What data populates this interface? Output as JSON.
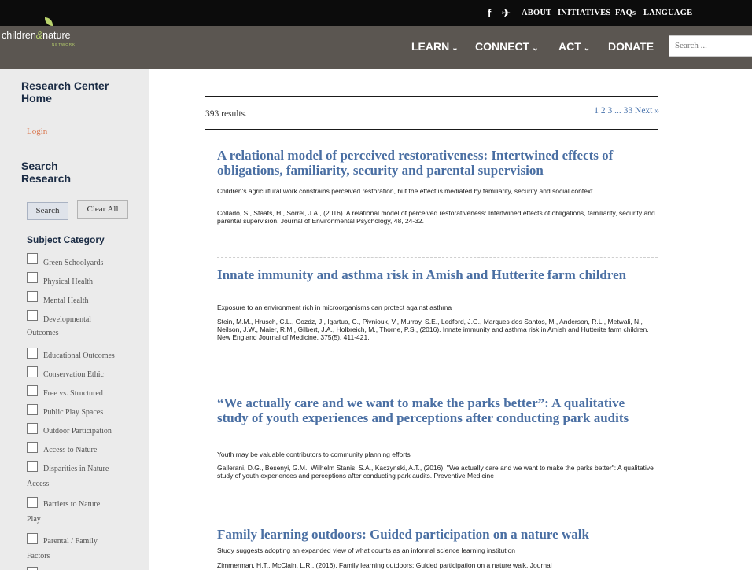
{
  "topbar": {
    "facebook_icon": "f",
    "twitter_icon": "✈",
    "links": [
      "ABOUT",
      "INITIATIVES",
      "FAQs",
      "LANGUAGE"
    ]
  },
  "logo": {
    "text_left": "children",
    "text_and": "&",
    "text_right": "nature",
    "sub": "NETWORK"
  },
  "nav": {
    "items": [
      "LEARN",
      "CONNECT",
      "ACT",
      "DONATE"
    ],
    "chevron": "⌄",
    "search_placeholder": "Search ..."
  },
  "sidebar": {
    "home_heading": "Research Center Home",
    "login": "Login",
    "search_heading": "Search Research",
    "search_button": "Search",
    "clear_button": "Clear All",
    "subject_heading": "Subject Category",
    "categories": [
      "Green Schoolyards",
      "Physical Health",
      "Mental Health",
      "Developmental",
      "Outcomes",
      "Educational Outcomes",
      "Conservation Ethic",
      "Free vs. Structured",
      "Public Play Spaces",
      "Outdoor Participation",
      "Access to Nature",
      "Disparities in Nature",
      "Access",
      "Barriers to Nature",
      "Play",
      "Parental / Family",
      "Factors"
    ]
  },
  "main": {
    "results_count": "393 results.",
    "pager": "1 2 3 ... 33 Next »",
    "results": [
      {
        "title": "A relational model of perceived restorativeness: Intertwined effects of obligations, familiarity, security and parental supervision",
        "summary": "Children's agricultural work constrains perceived restoration, but the effect is mediated by familiarity, security and social context",
        "citation": "Collado, S., Staats, H., Sorrel, J.A., (2016). A relational model of perceived restorativeness: Intertwined effects of obligations, familiarity, security and parental supervision. Journal of Environmental Psychology, 48, 24-32."
      },
      {
        "title": "Innate immunity and asthma risk in Amish and Hutterite farm children",
        "summary": "Exposure to an environment rich in microorganisms can protect against asthma",
        "citation": "Stein, M.M., Hrusch, C.L., Gozdz, J., Igartua, C., Pivniouk, V., Murray, S.E., Ledford, J.G., Marques dos Santos, M., Anderson, R.L., Metwali, N., Neilson, J.W., Maier, R.M., Gilbert, J.A., Holbreich, M., Thorne, P.S., (2016). Innate immunity and asthma risk in Amish and Hutterite farm children. New England Journal of Medicine, 375(5), 411-421."
      },
      {
        "title": "“We actually care and we want to make the parks better”: A qualitative study of youth experiences and perceptions after conducting park audits",
        "summary": "Youth may be valuable contributors to community planning efforts",
        "citation": "Gallerani, D.G., Besenyi, G.M., Wilhelm Stanis, S.A., Kaczynski, A.T., (2016). \"We actually care and we want to make the parks better\": A qualitative study of youth experiences and perceptions after conducting park audits. Preventive Medicine"
      },
      {
        "title": "Family learning outdoors: Guided participation on a nature walk",
        "summary": "Study suggests adopting an expanded view of what counts as an informal science learning institution",
        "citation": "Zimmerman, H.T., McClain, L.R., (2016). Family learning outdoors: Guided participation on a nature walk. Journal"
      }
    ]
  },
  "colors": {
    "topbar": "#0c0c0c",
    "navbar": "#5b5651",
    "sidebar": "#ebebeb",
    "title_link": "#4a6fa3",
    "login": "#d9734a",
    "logo_accent": "#b9d36d"
  }
}
